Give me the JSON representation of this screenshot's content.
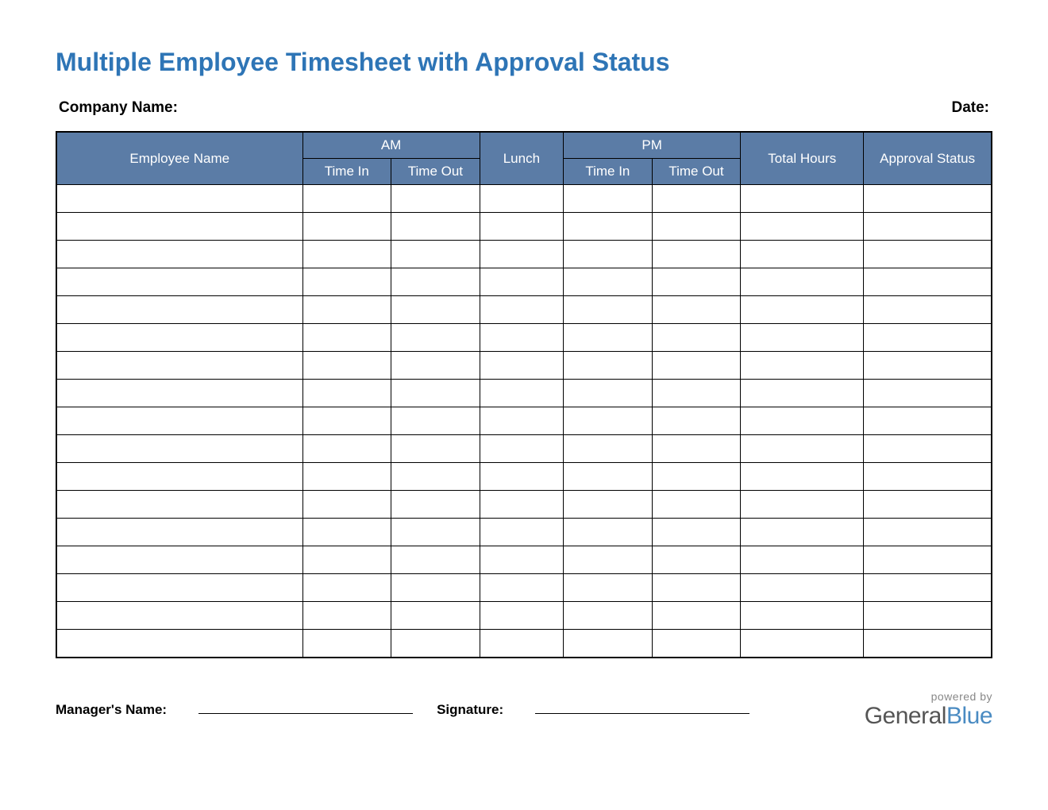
{
  "title": "Multiple Employee Timesheet with Approval Status",
  "header": {
    "company_label": "Company Name:",
    "date_label": "Date:"
  },
  "table": {
    "headers": {
      "employee_name": "Employee Name",
      "am": "AM",
      "am_time_in": "Time In",
      "am_time_out": "Time Out",
      "lunch": "Lunch",
      "pm": "PM",
      "pm_time_in": "Time In",
      "pm_time_out": "Time Out",
      "total_hours": "Total Hours",
      "approval_status": "Approval Status"
    },
    "row_count": 17
  },
  "footer": {
    "manager_label": "Manager's Name:",
    "signature_label": "Signature:",
    "powered_by": "powered by",
    "brand_general": "General",
    "brand_blue": "Blue"
  }
}
